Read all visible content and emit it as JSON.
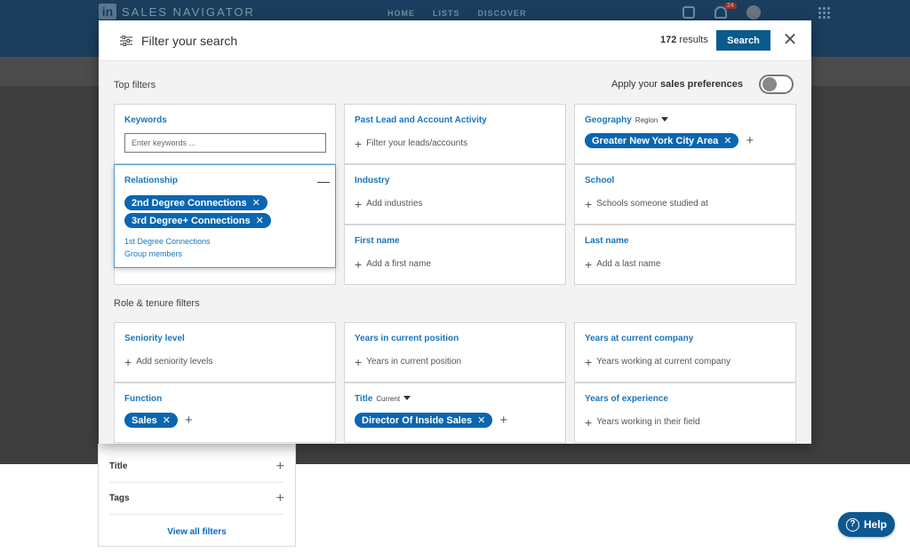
{
  "bg": {
    "logo_mark": "in",
    "logo_text": "SALES NAVIGATOR",
    "nav": [
      "HOME",
      "LISTS",
      "DISCOVER"
    ],
    "notif_count": "24",
    "panel_rows": [
      {
        "label": "Title"
      },
      {
        "label": "Tags"
      }
    ],
    "view_all": "View all filters",
    "help": "Help"
  },
  "modal": {
    "title": "Filter your search",
    "results_count": "172",
    "results_label": "results",
    "search_button": "Search",
    "close": "✕"
  },
  "sections": {
    "top": "Top filters",
    "role": "Role & tenure filters"
  },
  "prefs": {
    "label_prefix": "Apply your",
    "label_bold": "sales preferences",
    "enabled": false
  },
  "filters": {
    "keywords": {
      "title": "Keywords",
      "placeholder": "Enter keywords ..."
    },
    "relationship": {
      "title": "Relationship",
      "selected": [
        "2nd Degree Connections",
        "3rd Degree+ Connections"
      ],
      "options": [
        "1st Degree Connections",
        "Group members"
      ]
    },
    "past_activity": {
      "title": "Past Lead and Account Activity",
      "add": "Filter your leads/accounts"
    },
    "geography": {
      "title": "Geography",
      "sub": "Region",
      "selected": "Greater New York City Area"
    },
    "industry": {
      "title": "Industry",
      "add": "Add industries"
    },
    "school": {
      "title": "School",
      "add": "Schools someone studied at"
    },
    "first_name": {
      "title": "First name",
      "add": "Add a first name"
    },
    "last_name": {
      "title": "Last name",
      "add": "Add a last name"
    },
    "seniority": {
      "title": "Seniority level",
      "add": "Add seniority levels"
    },
    "years_position": {
      "title": "Years in current position",
      "add": "Years in current position"
    },
    "years_company": {
      "title": "Years at current company",
      "add": "Years working at current company"
    },
    "function": {
      "title": "Function",
      "selected": "Sales"
    },
    "title": {
      "title": "Title",
      "sub": "Current",
      "selected": "Director Of Inside Sales"
    },
    "experience": {
      "title": "Years of experience",
      "add": "Years working in their field"
    }
  }
}
